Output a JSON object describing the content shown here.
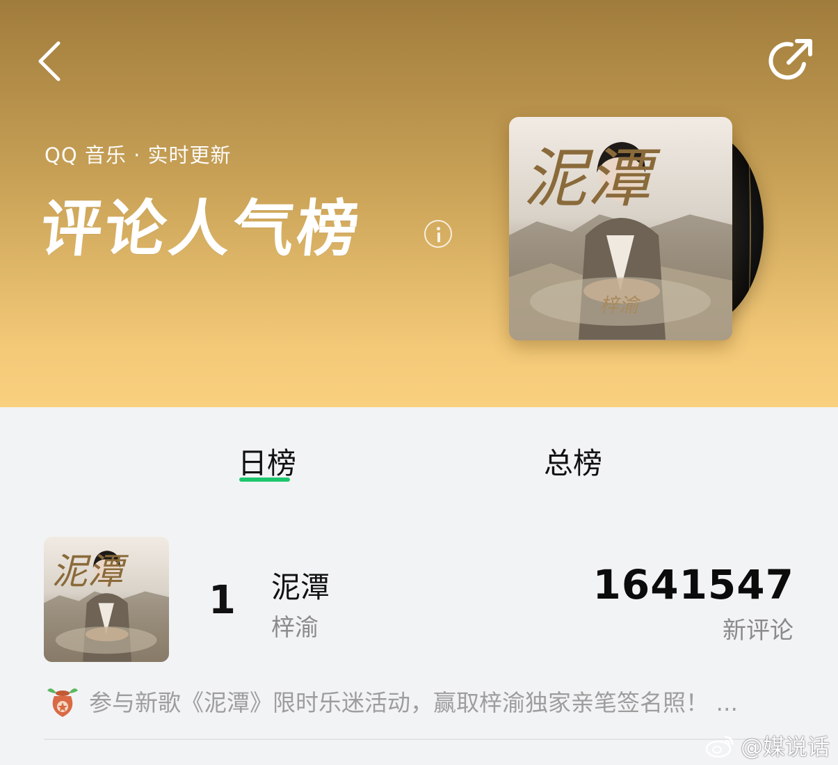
{
  "header": {
    "subtitle": "QQ 音乐 · 实时更新",
    "title": "评论人气榜",
    "accent_gradient": [
      "#a07c3c",
      "#f9d07e"
    ]
  },
  "cover_art": {
    "title_text": "泥潭",
    "signature_text": "梓渝"
  },
  "tabs": [
    {
      "label": "日榜",
      "active": true
    },
    {
      "label": "总榜",
      "active": false
    }
  ],
  "tab_accent": "#1ec66d",
  "entries": [
    {
      "rank": "1",
      "title": "泥潭",
      "artist": "梓渝",
      "count": "1641547",
      "count_label": "新评论"
    }
  ],
  "promo": {
    "text": "参与新歌《泥潭》限时乐迷活动，赢取梓渝独家亲笔签名照！ ..."
  },
  "watermark": {
    "text": "@媒说话"
  },
  "icons": [
    "back-arrow-icon",
    "share-icon",
    "info-icon",
    "gift-pouch-icon",
    "weibo-logo-icon"
  ]
}
